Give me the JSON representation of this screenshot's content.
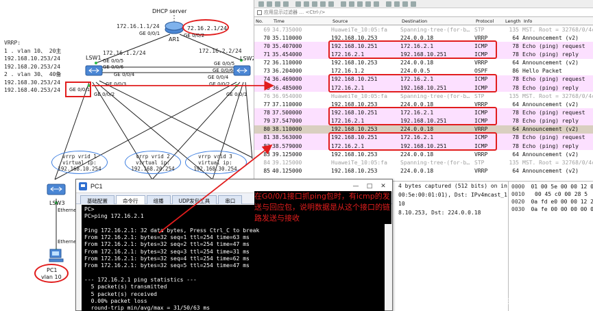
{
  "topology": {
    "dhcp_server_label": "DHCP server",
    "ar1_name": "AR1",
    "ar1_left_ip": "172.16.1.1/24",
    "ar1_right_ip": "72.16.2.1/24",
    "ar1_port_left": "GE 0/0/1",
    "ar1_port_right": "GE 0/0/2",
    "lsw1_name": "LSW1",
    "lsw1_ip": "172.16.1.2/24",
    "lsw2_name": "LSW2",
    "lsw2_ip": "172.16.2.2/24",
    "lsw3_name": "LSW3",
    "pc1_name": "PC1",
    "pc1_vlan": "vlan 10",
    "ports": {
      "lsw1_up": "GE 0/0/5",
      "lsw1_right": "GE 0/0/6",
      "lsw1_g4": "GE 0/0/4",
      "lsw1_g1": "GE 0/0/1",
      "lsw1_g2": "GE 0/0/2",
      "lsw1_g3": "GE 0/0/3",
      "lsw2_up": "GE 0/0/5",
      "lsw2_left": "GE 0/0/6",
      "lsw2_g4": "GE 0/0/4",
      "lsw2_g2": "GE 0/0/2",
      "lsw2_g1": "GE 0/0/1",
      "lsw3_eth": "Etherne",
      "pc_eth": "Etherne"
    },
    "vrrp_note": [
      "VRRP:",
      "1 . vlan 10、 20主",
      "192.168.10.253/24",
      "192.168.20.253/24",
      "2 . vlan 30、 40备",
      "192.168.30.253/24",
      "192.168.40.253/24"
    ],
    "vrrp_groups": [
      {
        "lines": [
          "vrrp vrid 1",
          "virtual ip:",
          "192.168.10.254"
        ]
      },
      {
        "lines": [
          "vrrp vrid 2",
          "virtual ip:",
          "192.168.20.254"
        ]
      },
      {
        "lines": [
          "vrrp vrid 3",
          "virtual ip:",
          "192.168.30.254"
        ]
      }
    ]
  },
  "wireshark": {
    "filter_placeholder": "应用显示过滤器 … <Ctrl-/>",
    "columns": [
      "No.",
      "Time",
      "Source",
      "Destination",
      "Protocol",
      "Length",
      "Info"
    ],
    "packets": [
      {
        "no": "69",
        "time": "34.735000",
        "src": "HuaweiTe_10:05:fa",
        "dst": "Spanning-tree-(for-b…",
        "proto": "STP",
        "len": "135",
        "info": "MST. Root = 32768/0/4c",
        "bg": "#ffffff",
        "fg": "#a0a0a0"
      },
      {
        "no": "70",
        "time": "35.110000",
        "src": "192.168.10.253",
        "dst": "224.0.0.18",
        "proto": "VRRP",
        "len": "64",
        "info": "Announcement (v2)",
        "bg": "#ffffff",
        "fg": "#111111"
      },
      {
        "no": "70",
        "time": "35.407000",
        "src": "192.168.10.251",
        "dst": "172.16.2.1",
        "proto": "ICMP",
        "len": "78",
        "info": "Echo (ping) request",
        "bg": "#fce0ff",
        "fg": "#111111"
      },
      {
        "no": "71",
        "time": "35.454000",
        "src": "172.16.2.1",
        "dst": "192.168.10.251",
        "proto": "ICMP",
        "len": "78",
        "info": "Echo (ping) reply",
        "bg": "#fce0ff",
        "fg": "#111111"
      },
      {
        "no": "72",
        "time": "36.110000",
        "src": "192.168.10.253",
        "dst": "224.0.0.18",
        "proto": "VRRP",
        "len": "64",
        "info": "Announcement (v2)",
        "bg": "#ffffff",
        "fg": "#111111"
      },
      {
        "no": "73",
        "time": "36.204000",
        "src": "172.16.1.2",
        "dst": "224.0.0.5",
        "proto": "OSPF",
        "len": "86",
        "info": "Hello Packet",
        "bg": "#ffffff",
        "fg": "#111111"
      },
      {
        "no": "74",
        "time": "36.469000",
        "src": "192.168.10.251",
        "dst": "172.16.2.1",
        "proto": "ICMP",
        "len": "78",
        "info": "Echo (ping) request",
        "bg": "#fce0ff",
        "fg": "#111111"
      },
      {
        "no": "75",
        "time": "36.485000",
        "src": "172.16.2.1",
        "dst": "192.168.10.251",
        "proto": "ICMP",
        "len": "78",
        "info": "Echo (ping) reply",
        "bg": "#fce0ff",
        "fg": "#111111"
      },
      {
        "no": "76",
        "time": "36.954000",
        "src": "HuaweiTe_10:05:fa",
        "dst": "Spanning-tree-(for-b…",
        "proto": "STP",
        "len": "135",
        "info": "MST. Root = 32768/0/4c",
        "bg": "#ffffff",
        "fg": "#a0a0a0"
      },
      {
        "no": "77",
        "time": "37.110000",
        "src": "192.168.10.253",
        "dst": "224.0.0.18",
        "proto": "VRRP",
        "len": "64",
        "info": "Announcement (v2)",
        "bg": "#ffffff",
        "fg": "#111111"
      },
      {
        "no": "78",
        "time": "37.500000",
        "src": "192.168.10.251",
        "dst": "172.16.2.1",
        "proto": "ICMP",
        "len": "78",
        "info": "Echo (ping) request",
        "bg": "#fce0ff",
        "fg": "#111111"
      },
      {
        "no": "79",
        "time": "37.547000",
        "src": "172.16.2.1",
        "dst": "192.168.10.251",
        "proto": "ICMP",
        "len": "78",
        "info": "Echo (ping) reply",
        "bg": "#fce0ff",
        "fg": "#111111"
      },
      {
        "no": "80",
        "time": "38.110000",
        "src": "192.168.10.253",
        "dst": "224.0.0.18",
        "proto": "VRRP",
        "len": "64",
        "info": "Announcement (v2)",
        "bg": "#d9cfc0",
        "fg": "#111111"
      },
      {
        "no": "81",
        "time": "38.563000",
        "src": "192.168.10.251",
        "dst": "172.16.2.1",
        "proto": "ICMP",
        "len": "78",
        "info": "Echo (ping) request",
        "bg": "#fce0ff",
        "fg": "#111111"
      },
      {
        "no": "82",
        "time": "38.579000",
        "src": "172.16.2.1",
        "dst": "192.168.10.251",
        "proto": "ICMP",
        "len": "78",
        "info": "Echo (ping) reply",
        "bg": "#fce0ff",
        "fg": "#111111"
      },
      {
        "no": "83",
        "time": "39.125000",
        "src": "192.168.10.253",
        "dst": "224.0.0.18",
        "proto": "VRRP",
        "len": "64",
        "info": "Announcement (v2)",
        "bg": "#ffffff",
        "fg": "#111111"
      },
      {
        "no": "84",
        "time": "39.125000",
        "src": "HuaweiTe_10:05:fa",
        "dst": "Spanning-tree-(for-b…",
        "proto": "STP",
        "len": "135",
        "info": "MST. Root = 32768/0/4c",
        "bg": "#ffffff",
        "fg": "#a0a0a0"
      },
      {
        "no": "85",
        "time": "40.125000",
        "src": "192.168.10.253",
        "dst": "224.0.0.18",
        "proto": "VRRP",
        "len": "64",
        "info": "Announcement (v2)",
        "bg": "#ffffff",
        "fg": "#111111"
      }
    ],
    "details": [
      "4 bytes captured (512 bits) on in",
      "00:5e:00:01:01), Dst: IPv4mcast_1",
      "10",
      "8.10.253, Dst: 224.0.0.18"
    ],
    "hex": [
      {
        "off": "0000",
        "bytes": "01 00 5e 00 00 12 0"
      },
      {
        "off": "0010",
        "bytes": "00 45 c0 00 28 5"
      },
      {
        "off": "0020",
        "bytes": "0a fd e0 00 00 12 2"
      },
      {
        "off": "0030",
        "bytes": "0a fe 00 00 00 00 0"
      }
    ]
  },
  "pc_window": {
    "title": "PC1",
    "tabs": [
      "基础配置",
      "命令行",
      "组播",
      "UDP发包工具",
      "串口"
    ],
    "active_tab": 1,
    "terminal_lines": [
      "PC>",
      "PC>ping 172.16.2.1",
      "",
      "Ping 172.16.2.1: 32 data bytes, Press Ctrl_C to break",
      "From 172.16.2.1: bytes=32 seq=1 ttl=254 time=63 ms",
      "From 172.16.2.1: bytes=32 seq=2 ttl=254 time=47 ms",
      "From 172.16.2.1: bytes=32 seq=3 ttl=254 time=31 ms",
      "From 172.16.2.1: bytes=32 seq=4 ttl=254 time=62 ms",
      "From 172.16.2.1: bytes=32 seq=5 ttl=254 time=47 ms",
      "",
      "--- 172.16.2.1 ping statistics ---",
      "  5 packet(s) transmitted",
      "  5 packet(s) received",
      "  0.00% packet loss",
      "  round-trip min/avg/max = 31/50/63 ms"
    ]
  },
  "annotation": {
    "text": "在G0/0/1接口抓ping包时，有icmp的发送与回应包，说明数据是从这个接口的链路发送与接收"
  },
  "watermark": "CSDN @weixin_48875093",
  "colors": {
    "highlight_red": "#e11d1d",
    "icmp_row": "#fce0ff",
    "selected_row": "#d9cfc0",
    "terminal_bg": "#000000",
    "vrrp_ellipse": "#3b7de0"
  }
}
